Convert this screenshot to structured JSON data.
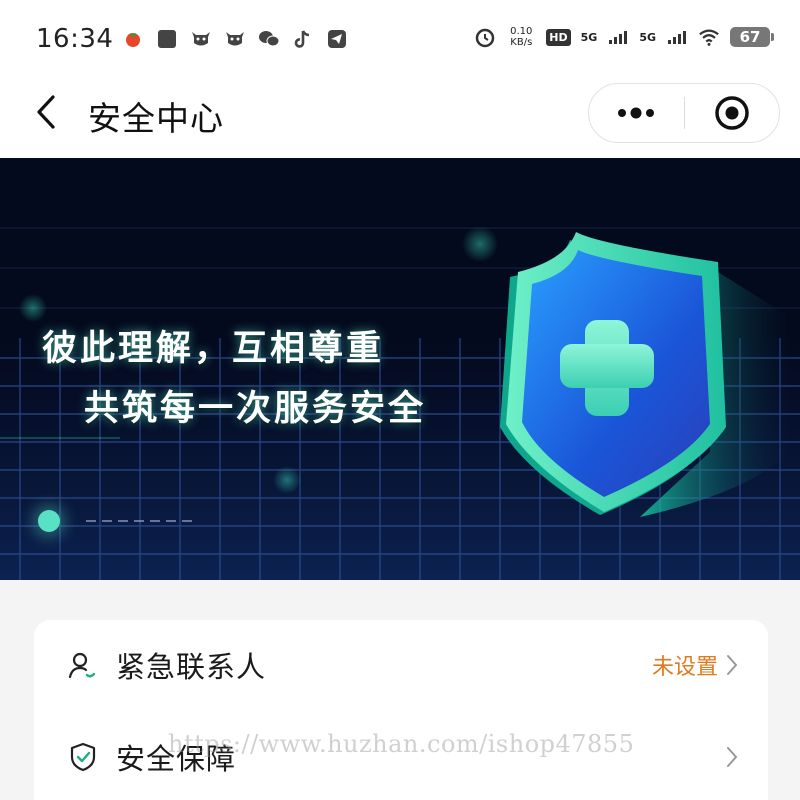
{
  "status_bar": {
    "time": "16:34",
    "left_icons": [
      "tomato-app-icon",
      "square-app-icon",
      "cow-app-icon",
      "cow-app-icon-2",
      "wechat-icon",
      "tiktok-icon",
      "telegram-icon"
    ],
    "net_speed_value": "0.10",
    "net_speed_unit": "KB/s",
    "hd_label": "HD",
    "signal_1_label": "5G",
    "signal_2_label": "5G",
    "battery": "67"
  },
  "nav": {
    "title": "安全中心"
  },
  "banner": {
    "line1": "彼此理解，互相尊重",
    "line2": "共筑每一次服务安全",
    "accent_color": "#5ae0c4",
    "background_color": "#040a1e"
  },
  "card": {
    "items": [
      {
        "label": "紧急联系人",
        "status": "未设置",
        "icon": "user-contact-icon"
      },
      {
        "label": "安全保障",
        "status": "",
        "icon": "shield-check-icon"
      }
    ]
  },
  "watermark": "https://www.huzhan.com/ishop47855",
  "colors": {
    "status_orange": "#e07a1f",
    "page_bg": "#f4f4f4"
  }
}
